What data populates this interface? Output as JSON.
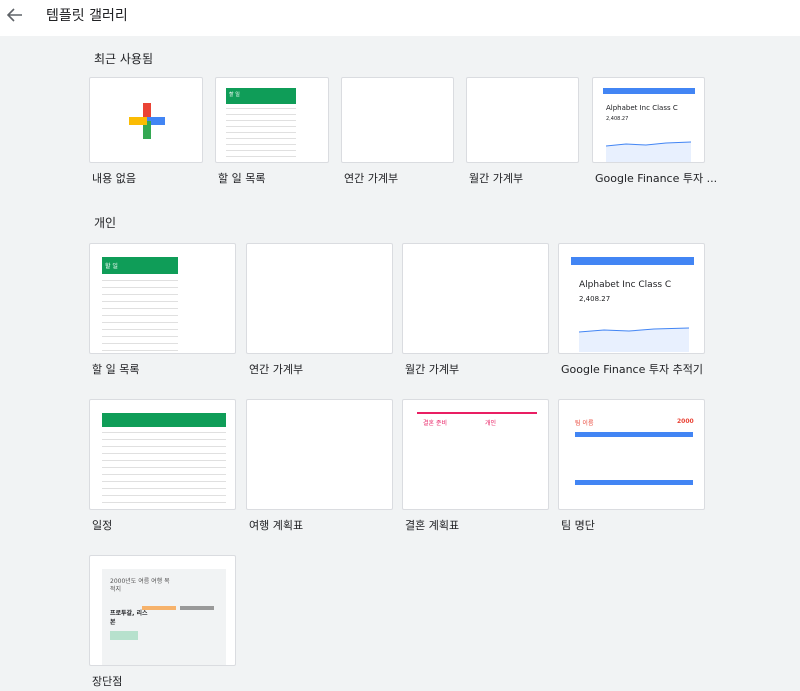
{
  "header": {
    "title": "템플릿 갤러리"
  },
  "sections": {
    "recent": "최근 사용됨",
    "personal": "개인"
  },
  "recent": [
    "내용 없음",
    "할 일 목록",
    "연간 가계부",
    "월간 가계부",
    "Google Finance 투자 ..."
  ],
  "personal": [
    "할 일 목록",
    "연간 가계부",
    "월간 가계부",
    "Google Finance 투자 추적기",
    "일정",
    "여행 계획표",
    "결혼 계획표",
    "팀 명단",
    "장단점"
  ],
  "thumbs": {
    "todo_title": "할 일",
    "finance_name": "Alphabet Inc Class C",
    "finance_price": "2,408.27",
    "team_title": "팀 이름",
    "team_year": "2000",
    "wedding_left": "결혼 준비",
    "wedding_right": "개인",
    "proscons_title": "2000년도 여름 여행 목적지",
    "proscons_a": "프로투갈, 리스본"
  },
  "colors": {
    "green": "#0f9d58",
    "blue": "#4285f4",
    "red": "#ea4335",
    "yellow": "#fbbc04",
    "pink": "#e91e63"
  }
}
